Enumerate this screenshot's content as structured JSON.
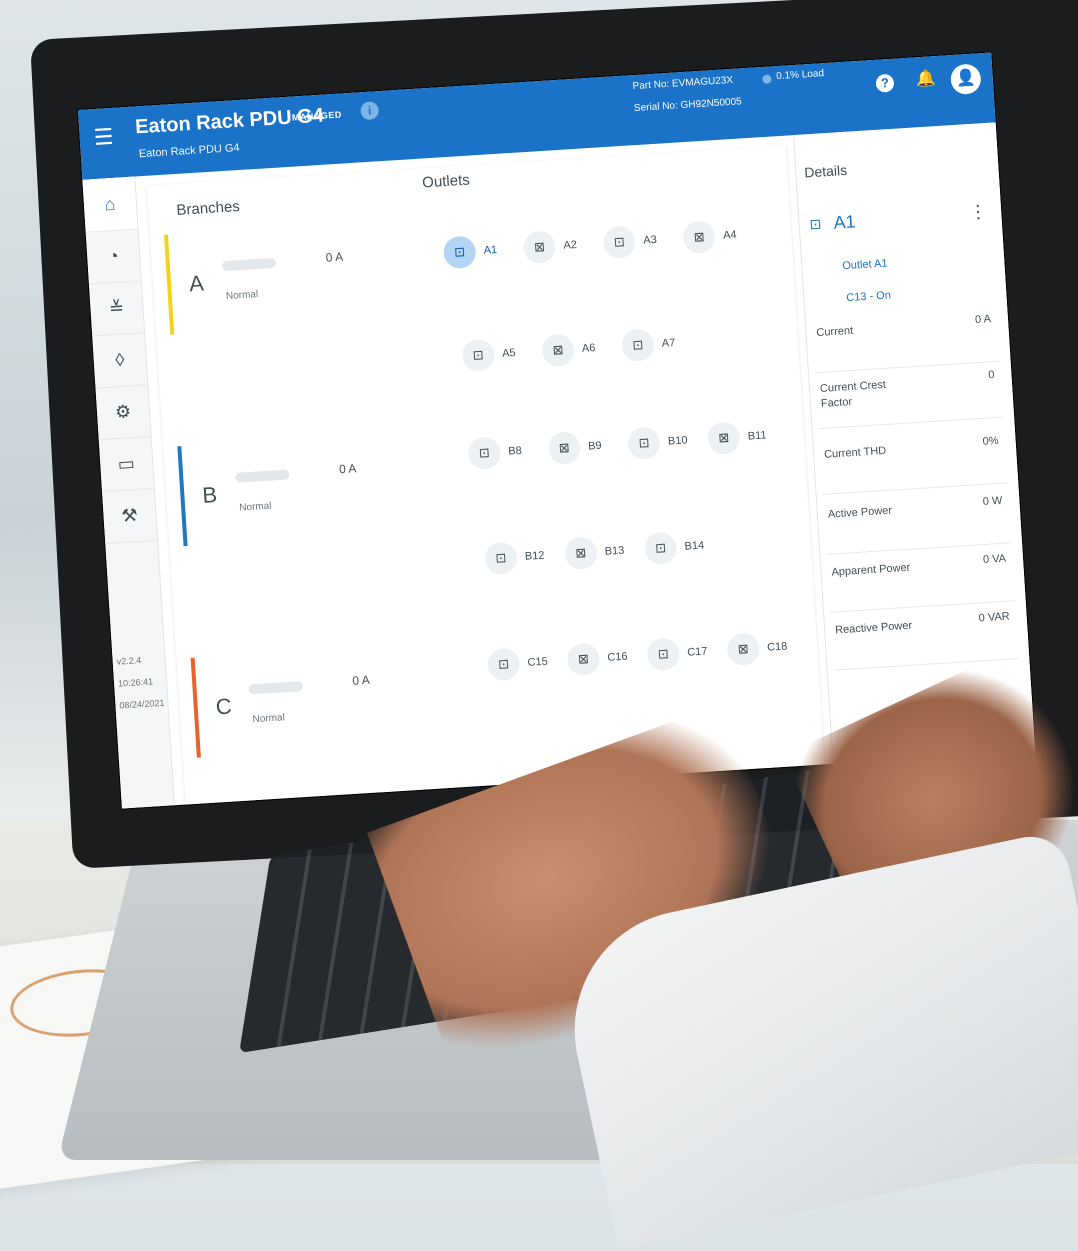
{
  "app": {
    "title": "Eaton Rack PDU G4",
    "badge": "MANAGED",
    "subtitle": "Eaton Rack PDU G4",
    "part_no": "Part No: EVMAGU23X",
    "serial_no": "Serial No: GH92N50005",
    "load": "0.1% Load"
  },
  "rail": {
    "items": [
      {
        "icon": "home-icon",
        "glyph": "⌂"
      },
      {
        "icon": "gauge-icon",
        "glyph": "◔"
      },
      {
        "icon": "sliders-icon",
        "glyph": "≚"
      },
      {
        "icon": "drop-icon",
        "glyph": "◊"
      },
      {
        "icon": "gear-icon",
        "glyph": "⚙"
      },
      {
        "icon": "network-icon",
        "glyph": "▭"
      },
      {
        "icon": "wrench-icon",
        "glyph": "⚒"
      }
    ],
    "version": "v2.2.4",
    "time": "10:26:41",
    "date": "08/24/2021"
  },
  "panel": {
    "branches_title": "Branches",
    "outlets_title": "Outlets"
  },
  "branches": [
    {
      "letter": "A",
      "status": "Normal",
      "current": "0 A",
      "color": "#f2d21b",
      "outlets": [
        [
          "A1",
          "A2",
          "A3",
          "A4"
        ],
        [
          "A5",
          "A6",
          "A7"
        ]
      ]
    },
    {
      "letter": "B",
      "status": "Normal",
      "current": "0 A",
      "color": "#1f78c1",
      "outlets": [
        [
          "B8",
          "B9",
          "B10",
          "B11"
        ],
        [
          "B12",
          "B13",
          "B14"
        ]
      ]
    },
    {
      "letter": "C",
      "status": "Normal",
      "current": "0 A",
      "color": "#e8632b",
      "outlets": [
        [
          "C15",
          "C16",
          "C17",
          "C18"
        ]
      ]
    }
  ],
  "details": {
    "title": "Details",
    "outlet_name": "A1",
    "outlet_label": "Outlet A1",
    "outlet_type": "C13 - On",
    "metrics": [
      {
        "label": "Current",
        "value": "0 A"
      },
      {
        "label": "Current Crest Factor",
        "value": "0"
      },
      {
        "label": "Current THD",
        "value": "0%"
      },
      {
        "label": "Active Power",
        "value": "0 W"
      },
      {
        "label": "Apparent Power",
        "value": "0 VA"
      },
      {
        "label": "Reactive Power",
        "value": "0 VAR"
      }
    ]
  },
  "colors": {
    "accent": "#1a73c8",
    "branch_a": "#f2d21b",
    "branch_b": "#1f78c1",
    "branch_c": "#e8632b"
  }
}
